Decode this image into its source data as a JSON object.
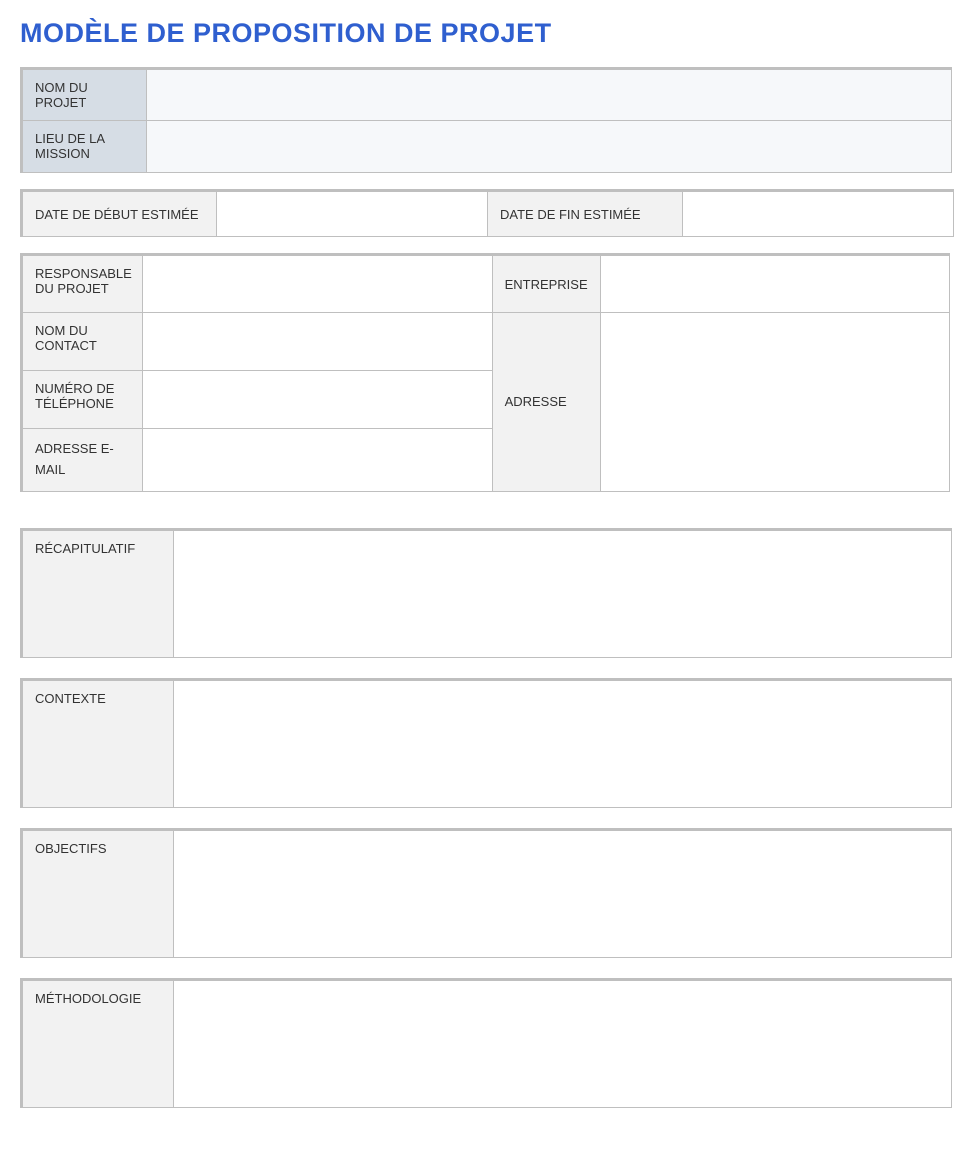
{
  "title": "MODÈLE DE PROPOSITION DE PROJET",
  "section1": {
    "project_name_label": "NOM DU PROJET",
    "project_name_value": "",
    "mission_location_label": "LIEU DE LA MISSION",
    "mission_location_value": ""
  },
  "section2": {
    "start_date_label": "DATE DE DÉBUT ESTIMÉE",
    "start_date_value": "",
    "end_date_label": "DATE DE FIN ESTIMÉE",
    "end_date_value": ""
  },
  "section3": {
    "manager_label": "RESPONSABLE DU PROJET",
    "manager_value": "",
    "company_label": "ENTREPRISE",
    "company_value": "",
    "contact_label": "NOM DU CONTACT",
    "contact_value": "",
    "address_label": "ADRESSE",
    "address_value": "",
    "phone_label": "NUMÉRO DE TÉLÉPHONE",
    "phone_value": "",
    "email_label": "ADRESSE E-MAIL",
    "email_value": ""
  },
  "big": {
    "summary_label": "RÉCAPITULATIF",
    "summary_value": "",
    "context_label": "CONTEXTE",
    "context_value": "",
    "objectives_label": "OBJECTIFS",
    "objectives_value": "",
    "methodology_label": "MÉTHODOLOGIE",
    "methodology_value": ""
  }
}
